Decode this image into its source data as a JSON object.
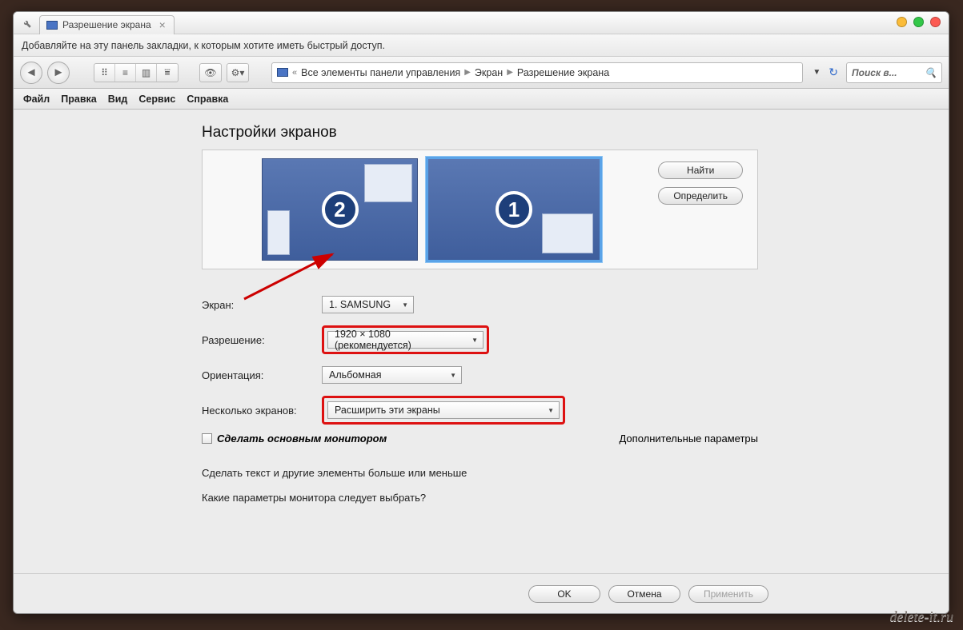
{
  "tab": {
    "title": "Разрешение экрана"
  },
  "bookmark_hint": "Добавляйте на эту панель закладки, к которым хотите иметь быстрый доступ.",
  "breadcrumb": {
    "item1": "Все элементы панели управления",
    "item2": "Экран",
    "item3": "Разрешение экрана"
  },
  "search": {
    "placeholder": "Поиск в..."
  },
  "menu": {
    "file": "Файл",
    "edit": "Правка",
    "view": "Вид",
    "service": "Сервис",
    "help": "Справка"
  },
  "page": {
    "title": "Настройки экранов",
    "monitor1_num": "1",
    "monitor2_num": "2",
    "find_btn": "Найти",
    "detect_btn": "Определить"
  },
  "form": {
    "screen_label": "Экран:",
    "screen_value": "1. SAMSUNG",
    "resolution_label": "Разрешение:",
    "resolution_value": "1920 × 1080 (рекомендуется)",
    "orientation_label": "Ориентация:",
    "orientation_value": "Альбомная",
    "multiple_label": "Несколько экранов:",
    "multiple_value": "Расширить эти экраны",
    "make_main_label": "Сделать основным монитором",
    "advanced_link": "Дополнительные параметры",
    "text_size_link": "Сделать текст и другие элементы больше или меньше",
    "which_params_link": "Какие параметры монитора следует выбрать?"
  },
  "footer": {
    "ok": "OK",
    "cancel": "Отмена",
    "apply": "Применить"
  },
  "watermark": "delete-it.ru"
}
